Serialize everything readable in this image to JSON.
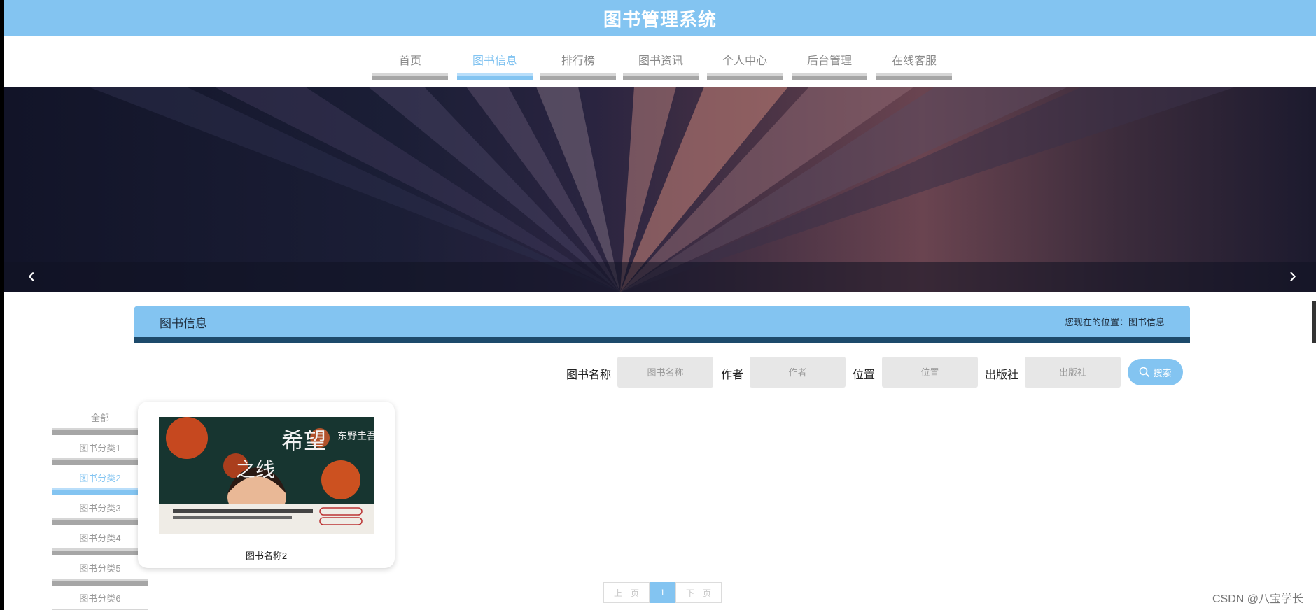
{
  "header": {
    "title": "图书管理系统"
  },
  "nav": {
    "items": [
      {
        "label": "首页",
        "active": false
      },
      {
        "label": "图书信息",
        "active": true
      },
      {
        "label": "排行榜",
        "active": false
      },
      {
        "label": "图书资讯",
        "active": false
      },
      {
        "label": "个人中心",
        "active": false
      },
      {
        "label": "后台管理",
        "active": false
      },
      {
        "label": "在线客服",
        "active": false
      }
    ]
  },
  "banner": {
    "prev_icon": "chevron-left-icon",
    "next_icon": "chevron-right-icon"
  },
  "section": {
    "title": "图书信息",
    "breadcrumb": "您现在的位置：图书信息"
  },
  "search": {
    "fields": [
      {
        "label": "图书名称",
        "placeholder": "图书名称"
      },
      {
        "label": "作者",
        "placeholder": "作者"
      },
      {
        "label": "位置",
        "placeholder": "位置"
      },
      {
        "label": "出版社",
        "placeholder": "出版社"
      }
    ],
    "button_label": "搜索",
    "button_icon": "search-icon"
  },
  "categories": [
    {
      "label": "全部",
      "active": false
    },
    {
      "label": "图书分类1",
      "active": false
    },
    {
      "label": "图书分类2",
      "active": true
    },
    {
      "label": "图书分类3",
      "active": false
    },
    {
      "label": "图书分类4",
      "active": false
    },
    {
      "label": "图书分类5",
      "active": false
    },
    {
      "label": "图书分类6",
      "active": false
    }
  ],
  "books": [
    {
      "name": "图书名称2",
      "cover_text": {
        "title_a": "希望",
        "title_b": "之线",
        "author": "东野圭吾"
      }
    }
  ],
  "pagination": {
    "prev": "上一页",
    "current": "1",
    "next": "下一页"
  },
  "watermark": "CSDN @八宝学长",
  "colors": {
    "accent": "#83c4f1",
    "dark_accent": "#1d4a6b",
    "bar_gray": "#a6a6a6"
  }
}
